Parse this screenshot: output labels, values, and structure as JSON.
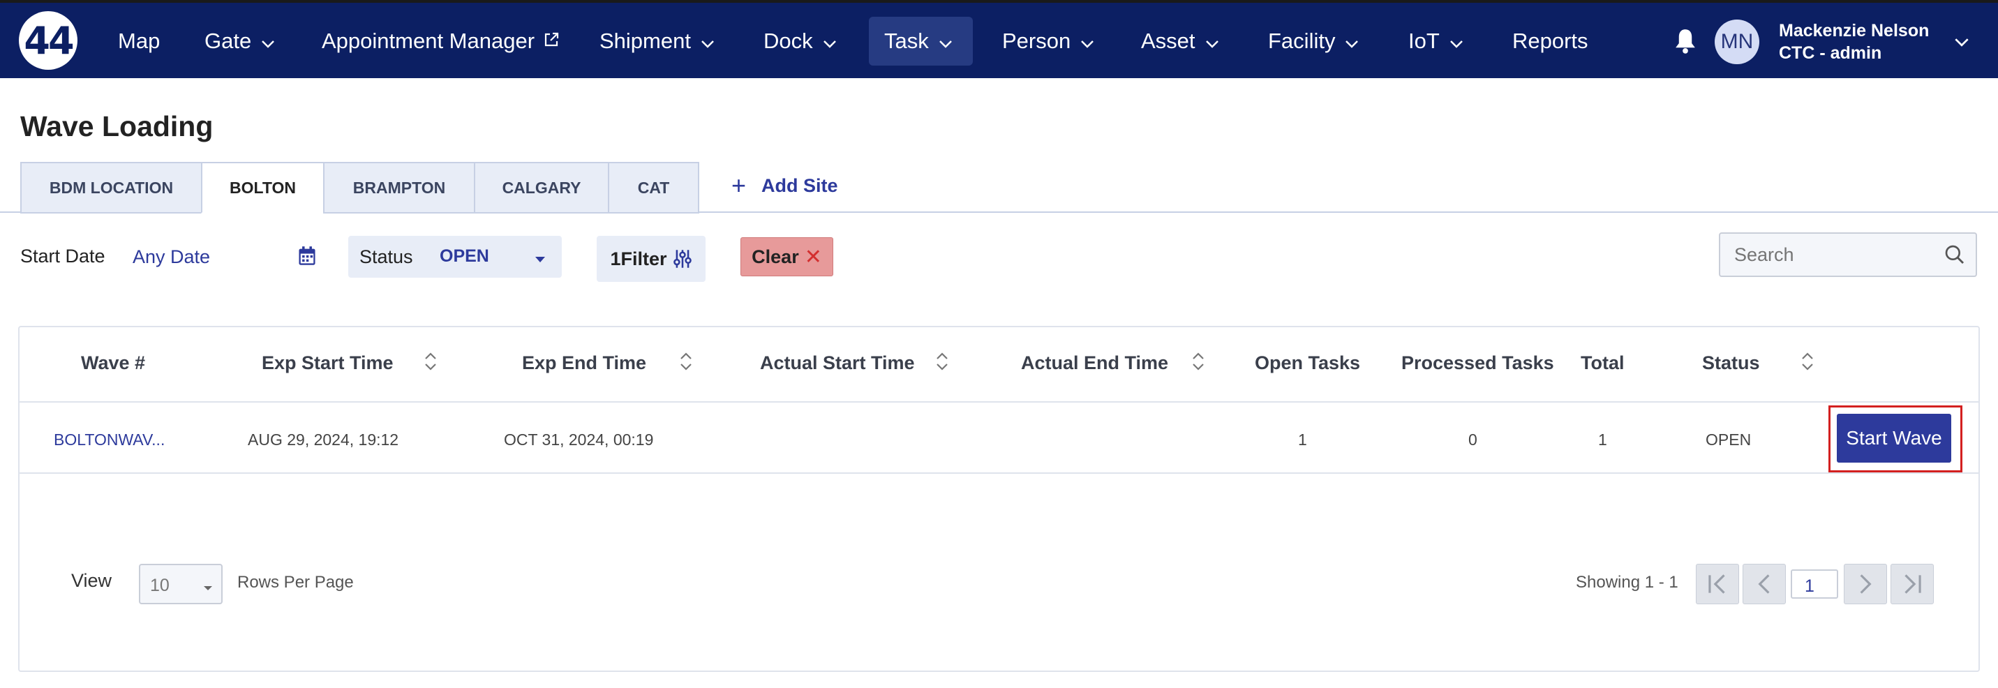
{
  "app": {
    "logo_text": "44"
  },
  "nav": {
    "items": [
      {
        "label": "Map"
      },
      {
        "label": "Gate"
      },
      {
        "label": "Appointment Manager"
      },
      {
        "label": "Shipment"
      },
      {
        "label": "Dock"
      },
      {
        "label": "Task",
        "active": true
      },
      {
        "label": "Person"
      },
      {
        "label": "Asset"
      },
      {
        "label": "Facility"
      },
      {
        "label": "IoT"
      },
      {
        "label": "Reports"
      }
    ]
  },
  "user": {
    "initials": "MN",
    "name": "Mackenzie Nelson",
    "role": "CTC - admin"
  },
  "page": {
    "title": "Wave Loading"
  },
  "sites": {
    "tabs": [
      {
        "label": "BDM LOCATION"
      },
      {
        "label": "BOLTON",
        "selected": true
      },
      {
        "label": "BRAMPTON"
      },
      {
        "label": "CALGARY"
      },
      {
        "label": "CAT"
      }
    ],
    "add_label": "Add Site"
  },
  "filters": {
    "start_date_label": "Start Date",
    "start_date_value": "Any Date",
    "status_label": "Status",
    "status_value": "OPEN",
    "filter_count": "1",
    "filter_label": "Filter",
    "clear_label": "Clear",
    "search_placeholder": "Search"
  },
  "table": {
    "columns": [
      {
        "label": "Wave #",
        "sortable": false
      },
      {
        "label": "Exp Start Time",
        "sortable": true
      },
      {
        "label": "Exp End Time",
        "sortable": true
      },
      {
        "label": "Actual Start Time",
        "sortable": true
      },
      {
        "label": "Actual End Time",
        "sortable": true
      },
      {
        "label": "Open Tasks",
        "sortable": false
      },
      {
        "label": "Processed Tasks",
        "sortable": false
      },
      {
        "label": "Total",
        "sortable": false
      },
      {
        "label": "Status",
        "sortable": true
      }
    ],
    "rows": [
      {
        "wave": "BOLTONWAV...",
        "exp_start": "AUG 29, 2024, 19:12",
        "exp_end": "OCT 31, 2024, 00:19",
        "actual_start": "",
        "actual_end": "",
        "open_tasks": "1",
        "processed_tasks": "0",
        "total": "1",
        "status": "OPEN",
        "action_label": "Start Wave"
      }
    ]
  },
  "pagination": {
    "view_label": "View",
    "rows_per_page_value": "10",
    "rows_per_page_label": "Rows Per Page",
    "showing": "Showing 1 - 1",
    "page": "1"
  },
  "colors": {
    "nav_bg": "#0c1f63",
    "accent": "#2d3a9c",
    "clear_bg": "#e79a9a",
    "highlight": "#d32020"
  }
}
